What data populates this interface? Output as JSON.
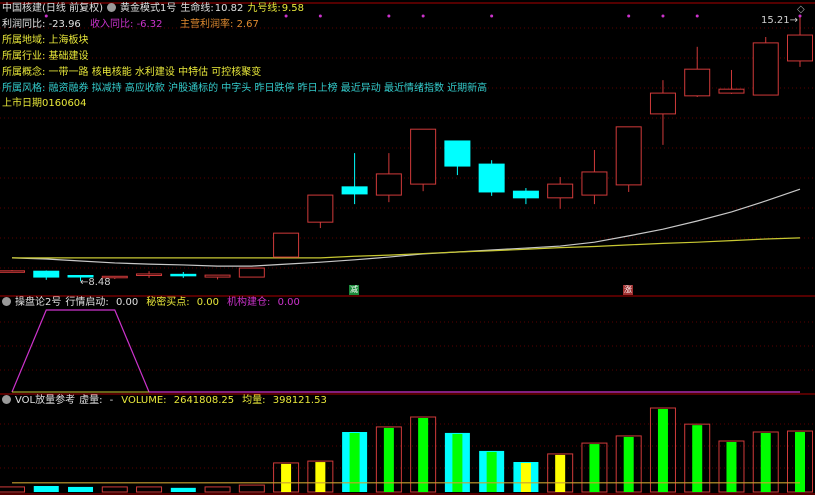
{
  "colors": {
    "up": "#d03a3a",
    "down": "#00ffff",
    "life_line": "#c8c8c8",
    "nine_line": "#c8c832",
    "marker": "#cc33cc",
    "grid": "#5a0000",
    "border": "#aa0000",
    "vol_green": "#00ff00",
    "vol_yellow": "#ffff00"
  },
  "header": {
    "stock": "中国核建(日线 前复权)",
    "indicator": "黄金模式1号",
    "life_label": "生命线:",
    "life_value": "10.82",
    "nine_label": "九号线:",
    "nine_value": "9.58"
  },
  "info": {
    "profit_yoy_label": "利润同比:",
    "profit_yoy": "-23.96",
    "revenue_yoy_label": "收入同比:",
    "revenue_yoy": "-6.32",
    "margin_label": "主营利润率:",
    "margin": "2.67",
    "region": "所属地域: 上海板块",
    "industry": "所属行业: 基础建设",
    "concept": "所属概念: 一带一路 核电核能 水利建设 中特估 可控核聚变",
    "style": "所属风格: 融资融券 拟减持 高应收款 沪股通标的 中字头 昨日跌停 昨日上榜 最近异动 最近情绪指数 近期新高",
    "listing": "上市日期0160604"
  },
  "annotations": {
    "low": "←8.48",
    "high": "15.21→",
    "signal_reduce": "减",
    "signal_rise": "涨"
  },
  "panel2": {
    "name": "操盘论2号",
    "l1": "行情启动:",
    "v1": "0.00",
    "l2": "秘密买点:",
    "v2": "0.00",
    "l3": "机构建仓:",
    "v3": "0.00"
  },
  "panel3": {
    "name": "VOL放量参考",
    "l1": "虚量:",
    "v1": "-",
    "l2": "VOLUME:",
    "v2": "2641808.25",
    "l3": "均量:",
    "v3": "398121.53"
  },
  "chart_data": [
    {
      "type": "candlestick",
      "ylim": [
        8.48,
        15.21
      ],
      "ohlc": [
        [
          8.72,
          8.76,
          8.7,
          8.74
        ],
        [
          8.73,
          8.75,
          8.51,
          8.58
        ],
        [
          8.62,
          8.62,
          8.48,
          8.6
        ],
        [
          8.57,
          8.6,
          8.53,
          8.6
        ],
        [
          8.62,
          8.73,
          8.56,
          8.66
        ],
        [
          8.65,
          8.71,
          8.56,
          8.63
        ],
        [
          8.58,
          8.63,
          8.52,
          8.63
        ],
        [
          8.58,
          8.82,
          8.58,
          8.81
        ],
        [
          9.09,
          9.7,
          9.09,
          9.7
        ],
        [
          9.98,
          10.67,
          9.83,
          10.67
        ],
        [
          10.88,
          11.74,
          10.44,
          10.7
        ],
        [
          10.67,
          11.74,
          10.49,
          11.21
        ],
        [
          10.95,
          12.35,
          10.77,
          12.35
        ],
        [
          12.05,
          12.05,
          11.18,
          11.41
        ],
        [
          11.46,
          11.56,
          10.65,
          10.75
        ],
        [
          10.77,
          10.85,
          10.44,
          10.6
        ],
        [
          10.6,
          11.13,
          10.32,
          10.95
        ],
        [
          10.67,
          11.82,
          10.44,
          11.26
        ],
        [
          10.93,
          12.41,
          10.75,
          12.41
        ],
        [
          12.74,
          13.6,
          11.95,
          13.27
        ],
        [
          13.2,
          14.45,
          13.17,
          13.88
        ],
        [
          13.27,
          13.86,
          13.25,
          13.37
        ],
        [
          13.22,
          14.7,
          13.22,
          14.55
        ],
        [
          14.09,
          15.21,
          13.94,
          14.75
        ]
      ],
      "series": [
        {
          "name": "生命线",
          "values": [
            9.07,
            9.04,
            8.99,
            8.94,
            8.91,
            8.89,
            8.86,
            8.86,
            8.91,
            8.96,
            9.02,
            9.09,
            9.17,
            9.22,
            9.27,
            9.32,
            9.37,
            9.47,
            9.63,
            9.8,
            10.01,
            10.24,
            10.52,
            10.82
          ]
        },
        {
          "name": "九号线",
          "values": [
            9.07,
            9.07,
            9.07,
            9.07,
            9.07,
            9.07,
            9.07,
            9.07,
            9.07,
            9.07,
            9.11,
            9.14,
            9.18,
            9.22,
            9.25,
            9.29,
            9.33,
            9.36,
            9.4,
            9.44,
            9.47,
            9.51,
            9.55,
            9.58
          ]
        }
      ],
      "top_markers": [
        1,
        8,
        9,
        11,
        12,
        14,
        18,
        19,
        20,
        23
      ],
      "signals": [
        {
          "index": 10,
          "label": "减"
        },
        {
          "index": 18,
          "label": "涨"
        }
      ],
      "low_point": {
        "index": 2,
        "value": 8.48
      },
      "high_point": {
        "index": 23,
        "value": 15.21
      }
    },
    {
      "type": "line",
      "ylim": [
        0,
        100
      ],
      "series": [
        {
          "name": "行情启动",
          "values": [
            0,
            100,
            100,
            100,
            0,
            0,
            0,
            0,
            0,
            0,
            0,
            0,
            0,
            0,
            0,
            0,
            0,
            0,
            0,
            0,
            0,
            0,
            0,
            0
          ]
        }
      ]
    },
    {
      "type": "bar",
      "values": [
        220000,
        260000,
        220000,
        220000,
        220000,
        180000,
        220000,
        300000,
        1260000,
        1340000,
        2600000,
        2820000,
        3250000,
        2560000,
        1780000,
        1300000,
        1650000,
        2120000,
        2430000,
        3640000,
        2940000,
        2210000,
        2600000,
        2641808.25
      ],
      "outline": [
        "up",
        "down",
        "down",
        "up",
        "up",
        "down",
        "up",
        "up",
        "up",
        "up",
        "down",
        "up",
        "up",
        "down",
        "down",
        "down",
        "up",
        "up",
        "up",
        "up",
        "up",
        "up",
        "up",
        "up"
      ],
      "inner": [
        "none",
        "none",
        "none",
        "none",
        "none",
        "none",
        "none",
        "none",
        "yellow",
        "yellow",
        "green",
        "green",
        "green",
        "green",
        "green",
        "yellow",
        "yellow",
        "green",
        "green",
        "green",
        "green",
        "green",
        "green",
        "green"
      ],
      "average": 398121.53
    }
  ]
}
